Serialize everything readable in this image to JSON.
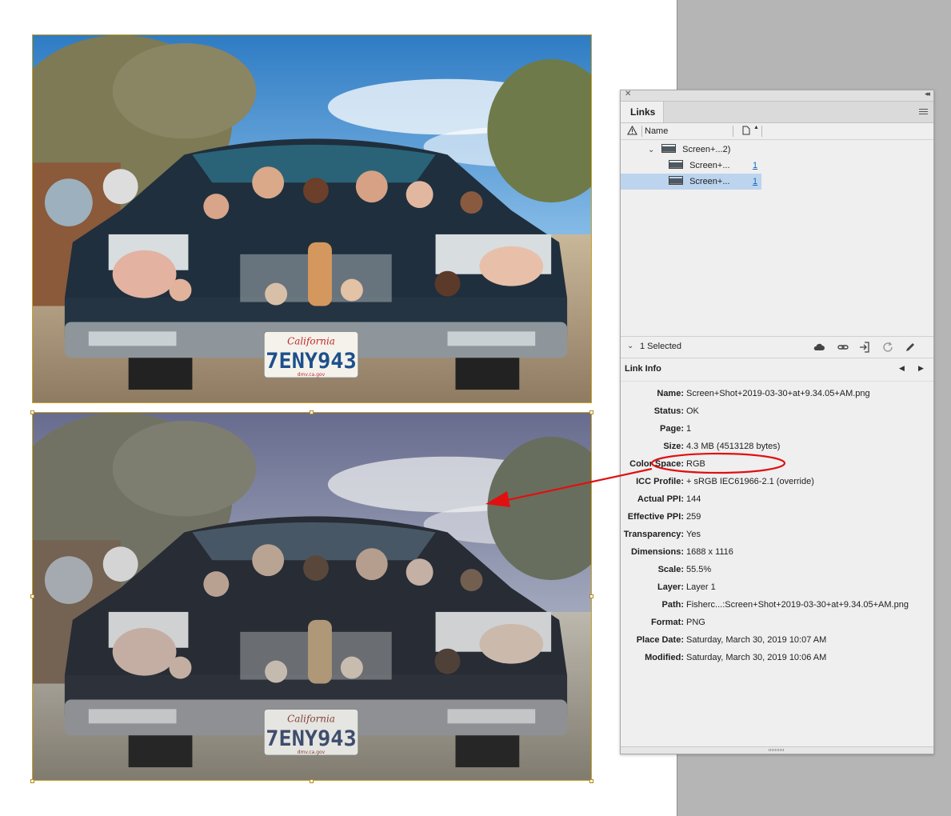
{
  "panel": {
    "tab_label": "Links",
    "column_name": "Name",
    "links": [
      {
        "name": "Screen+...2)",
        "expanded": true
      },
      {
        "name": "Screen+...",
        "page": "1"
      },
      {
        "name": "Screen+...",
        "page": "1",
        "selected": true
      }
    ],
    "selected_count": "1 Selected",
    "info_title": "Link Info",
    "info": [
      {
        "key": "Name:",
        "value": "Screen+Shot+2019-03-30+at+9.34.05+AM.png"
      },
      {
        "key": "Status:",
        "value": "OK"
      },
      {
        "key": "Page:",
        "value": "1"
      },
      {
        "key": "Size:",
        "value": "4.3 MB (4513128 bytes)"
      },
      {
        "key": "Color Space:",
        "value": "RGB"
      },
      {
        "key": "ICC Profile:",
        "value": "+ sRGB IEC61966-2.1 (override)"
      },
      {
        "key": "Actual PPI:",
        "value": "144"
      },
      {
        "key": "Effective PPI:",
        "value": "259"
      },
      {
        "key": "Transparency:",
        "value": "Yes"
      },
      {
        "key": "Dimensions:",
        "value": "1688 x 1116"
      },
      {
        "key": "Scale:",
        "value": "55.5%"
      },
      {
        "key": "Layer:",
        "value": "Layer 1"
      },
      {
        "key": "Path:",
        "value": "Fisherc...:Screen+Shot+2019-03-30+at+9.34.05+AM.png"
      },
      {
        "key": "Format:",
        "value": "PNG"
      },
      {
        "key": "Place Date:",
        "value": "Saturday, March 30, 2019 10:07 AM"
      },
      {
        "key": "Modified:",
        "value": "Saturday, March 30, 2019 10:06 AM"
      }
    ]
  },
  "images": {
    "top": {
      "plate_state": "California",
      "plate_number": "7ENY943",
      "plate_footer": "dmv.ca.gov"
    },
    "bottom": {
      "plate_state": "California",
      "plate_number": "7ENY943",
      "plate_footer": "dmv.ca.gov"
    }
  },
  "colors": {
    "frame_border": "#c9a227",
    "selection_highlight": "#bcd4ee",
    "annotation_red": "#e01010",
    "link_blue": "#1565c0",
    "pasteboard": "#b5b5b5"
  },
  "icons": [
    "close-icon",
    "collapse-icon",
    "panel-menu-icon",
    "warning-icon",
    "page-icon",
    "sort-icon",
    "chevron-down-icon",
    "cloud-icon",
    "relink-icon",
    "goto-link-icon",
    "update-link-icon",
    "edit-original-icon",
    "previous-icon",
    "next-icon"
  ]
}
